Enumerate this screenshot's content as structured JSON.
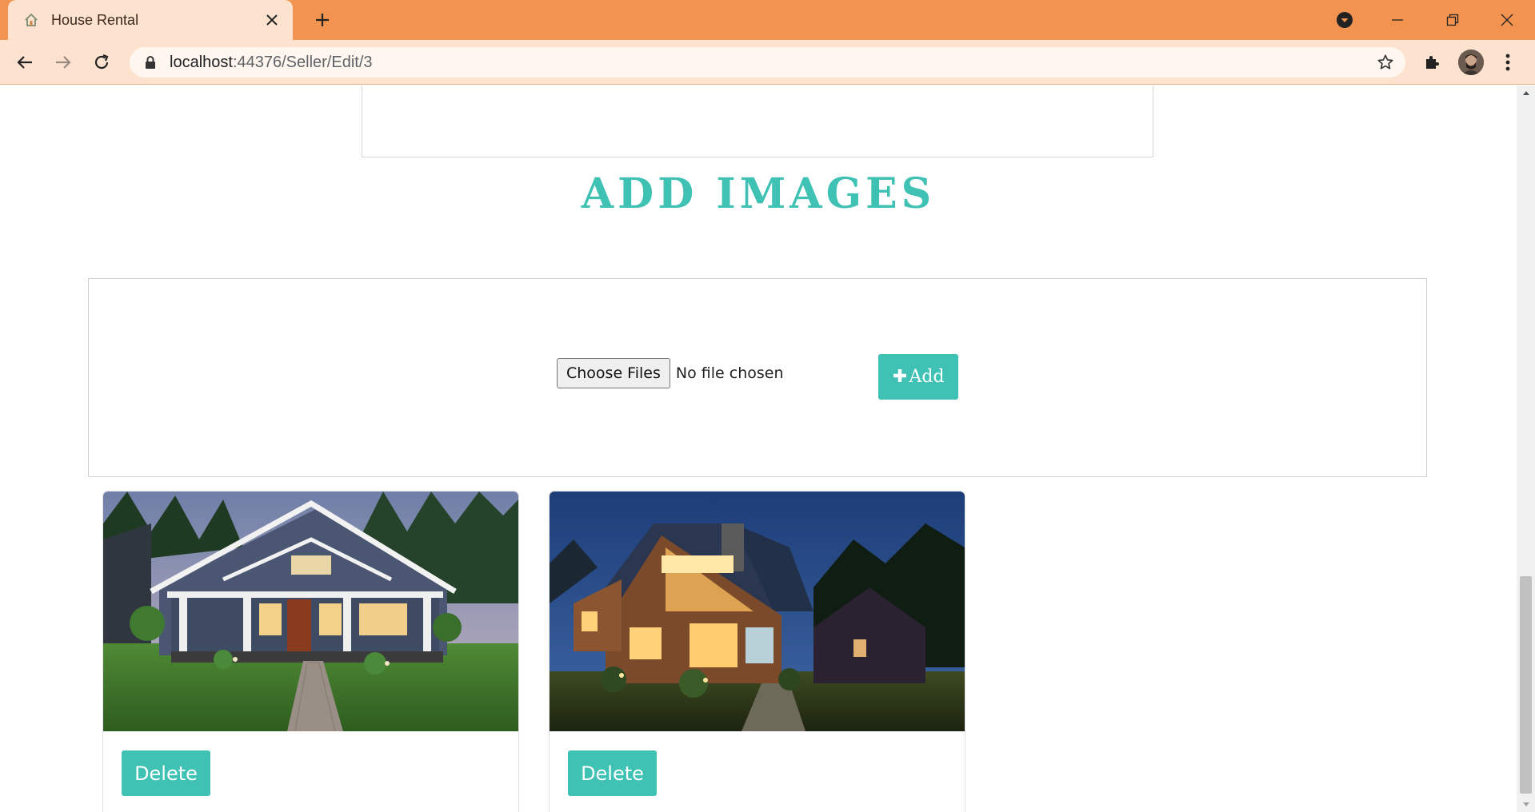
{
  "browser": {
    "tab_title": "House Rental",
    "url_host": "localhost",
    "url_path": ":44376/Seller/Edit/3",
    "icons": [
      "house-favicon-icon",
      "close-icon",
      "plus-icon",
      "profile-dropdown-icon",
      "minimize-icon",
      "restore-icon",
      "close-window-icon",
      "back-arrow-icon",
      "forward-arrow-icon",
      "reload-icon",
      "lock-icon",
      "star-icon",
      "puzzle-icon",
      "kebab-menu-icon"
    ]
  },
  "page": {
    "section_title": "ADD IMAGES",
    "file_input": {
      "button_label": "Choose Files",
      "status": "No file chosen"
    },
    "add_button": {
      "icon": "plus-icon",
      "label": "Add"
    },
    "images": [
      {
        "alt": "house-photo-day",
        "delete_label": "Delete"
      },
      {
        "alt": "house-photo-night",
        "delete_label": "Delete"
      }
    ]
  },
  "colors": {
    "accent": "#3fc1b4",
    "tabstrip": "#f2944f",
    "toolbar": "#fde3cf"
  }
}
